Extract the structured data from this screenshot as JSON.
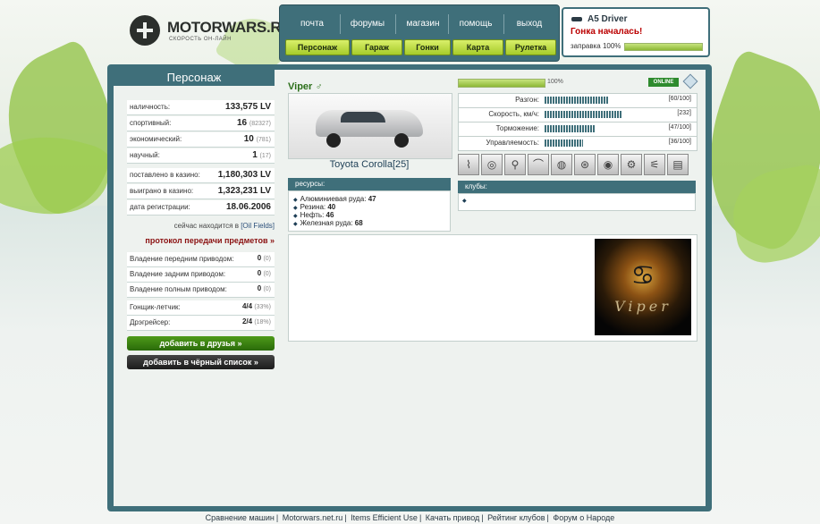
{
  "logo": {
    "name": "MOTORWARS.RU",
    "tagline": "СКОРОСТЬ ОН-ЛАЙН"
  },
  "nav": {
    "links": [
      "почта",
      "форумы",
      "магазин",
      "помощь",
      "выход"
    ],
    "buttons": [
      "Персонаж",
      "Гараж",
      "Гонки",
      "Карта",
      "Рулетка"
    ]
  },
  "status": {
    "driver": "A5 Driver",
    "race": "Гонка началась!",
    "fuel_label": "заправка 100%",
    "fuel_level": 1.0
  },
  "left": {
    "title": "Персонаж",
    "stats": [
      {
        "label": "наличность:",
        "value": "133,575 LV",
        "sub": ""
      },
      {
        "label": "спортивный:",
        "value": "16",
        "sub": "(82327)"
      },
      {
        "label": "экономический:",
        "value": "10",
        "sub": "(781)"
      },
      {
        "label": "научный:",
        "value": "1",
        "sub": "(17)"
      },
      {
        "label": "поставлено в казино:",
        "value": "1,180,303 LV",
        "sub": ""
      },
      {
        "label": "выиграно в казино:",
        "value": "1,323,231 LV",
        "sub": ""
      },
      {
        "label": "дата регистрации:",
        "value": "18.06.2006",
        "sub": ""
      }
    ],
    "location_prefix": "сейчас находится в",
    "location": "[Oil Fields]",
    "transfer_link": "протокол передачи предметов »",
    "drive": [
      {
        "label": "Владение передним приводом:",
        "value": "0",
        "sub": "(0)"
      },
      {
        "label": "Владение задним приводом:",
        "value": "0",
        "sub": "(0)"
      },
      {
        "label": "Владение полным приводом:",
        "value": "0",
        "sub": "(0)"
      }
    ],
    "ranks": [
      {
        "label": "Гонщик-летчик:",
        "value": "4/4",
        "sub": "(33%)"
      },
      {
        "label": "Дрэгрейсер:",
        "value": "2/4",
        "sub": "(18%)"
      }
    ],
    "add_friend": "добавить в друзья »",
    "add_black": "добавить в чёрный список »"
  },
  "player": {
    "name": "Viper",
    "gender_icon": "male-icon",
    "progress_label": "100%",
    "progress": 1.0,
    "online": "ONLINE"
  },
  "car": {
    "name": "Toyota Corolla[25]"
  },
  "specs": [
    {
      "label": "Разгон:",
      "value": "[60/100]",
      "level": 0.6
    },
    {
      "label": "Скорость, км/ч:",
      "value": "[232]",
      "level": 0.72
    },
    {
      "label": "Торможение:",
      "value": "[47/100]",
      "level": 0.47
    },
    {
      "label": "Управляемость:",
      "value": "[36/100]",
      "level": 0.36
    }
  ],
  "parts": [
    "shock-absorber-icon",
    "tire-icon",
    "spark-plug-icon",
    "spoiler-icon",
    "brake-icon",
    "wheel-icon",
    "turbo-icon",
    "engine-icon",
    "exhaust-icon",
    "radiator-icon"
  ],
  "resources": {
    "title": "ресурсы:",
    "items": [
      {
        "label": "Алюминиевая руда:",
        "value": "47"
      },
      {
        "label": "Резина:",
        "value": "40"
      },
      {
        "label": "Нефть:",
        "value": "46"
      },
      {
        "label": "Железная руда:",
        "value": "68"
      }
    ]
  },
  "clubs": {
    "title": "клубы:"
  },
  "avatar": {
    "text": "Viper",
    "glyph": "♋"
  },
  "footer": [
    "Сравнение машин",
    "Motorwars.net.ru",
    "Items Efficient Use",
    "Качать привод",
    "Рейтинг клубов",
    "Форум о Народе"
  ],
  "colors": {
    "frame": "#3f6f7a",
    "accent": "#a6cc2a",
    "alert": "#bb0000"
  }
}
